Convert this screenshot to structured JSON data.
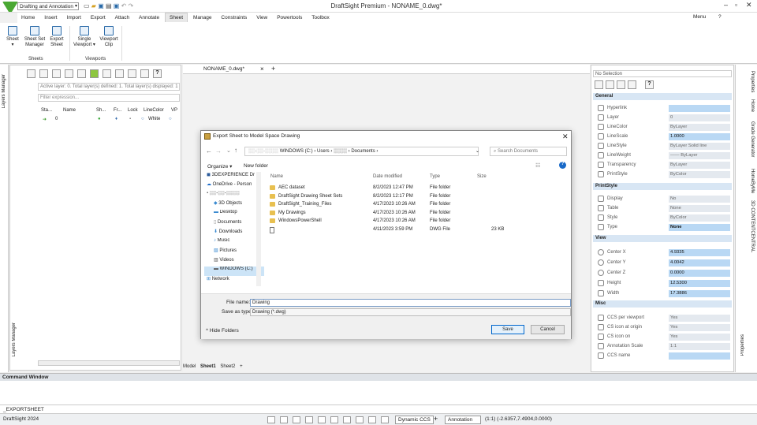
{
  "app": {
    "title": "DraftSight Premium - NONAME_0.dwg*",
    "workspace": "Drafting and Annotation",
    "menu_right": "Menu",
    "help": "?"
  },
  "menu": [
    "Home",
    "Insert",
    "Import",
    "Export",
    "Attach",
    "Annotate",
    "Sheet",
    "Manage",
    "Constraints",
    "View",
    "Powertools",
    "Toolbox"
  ],
  "ribbon": {
    "buttons": [
      {
        "label": "Sheet",
        "label2": "▾"
      },
      {
        "label": "Sheet Set",
        "label2": "Manager"
      },
      {
        "label": "Export",
        "label2": "Sheet"
      },
      {
        "label": "Single",
        "label2": "Viewport ▾"
      },
      {
        "label": "Viewport",
        "label2": "Clip"
      }
    ],
    "groups": [
      "Sheets",
      "Viewports"
    ]
  },
  "left_panel": {
    "tab_top": "Layers Manager",
    "tab_bottom": "Layers Manager",
    "info": "Active layer: 0. Total layer(s) defined: 1. Total layer(s) displayed: 1",
    "filter_placeholder": "Filter expression...",
    "columns": [
      "Sta...",
      "Name",
      "Sh...",
      "Fr...",
      "Lock",
      "LineColor",
      "VP"
    ],
    "row": {
      "name": "0",
      "color": "White"
    }
  },
  "drawing": {
    "tab": "NONAME_0.dwg*",
    "sheet_tabs": [
      "Model",
      "Sheet1",
      "Sheet2"
    ]
  },
  "properties": {
    "selection": "No Selection",
    "sections": {
      "general": "General",
      "printstyle": "PrintStyle",
      "view": "View",
      "misc": "Misc"
    },
    "general": [
      {
        "label": "Hyperlink",
        "value": ""
      },
      {
        "label": "Layer",
        "value": "0"
      },
      {
        "label": "LineColor",
        "value": "ByLayer"
      },
      {
        "label": "LineScale",
        "value": "1.0000"
      },
      {
        "label": "LineStyle",
        "value": "ByLayer    Solid line"
      },
      {
        "label": "LineWeight",
        "value": "—— ByLayer"
      },
      {
        "label": "Transparency",
        "value": "ByLayer"
      },
      {
        "label": "PrintStyle",
        "value": "ByColor"
      }
    ],
    "printstyle": [
      {
        "label": "Display",
        "value": "No"
      },
      {
        "label": "Table",
        "value": "None"
      },
      {
        "label": "Style",
        "value": "ByColor"
      },
      {
        "label": "Type",
        "value": "None"
      }
    ],
    "view": [
      {
        "label": "Center X",
        "value": "4.9335"
      },
      {
        "label": "Center Y",
        "value": "4.0042"
      },
      {
        "label": "Center Z",
        "value": "0.0000"
      },
      {
        "label": "Height",
        "value": "12.5300"
      },
      {
        "label": "Width",
        "value": "17.3886"
      }
    ],
    "misc": [
      {
        "label": "CCS per viewport",
        "value": "Yes"
      },
      {
        "label": "CS icon at origin",
        "value": "Yes"
      },
      {
        "label": "CS icon on",
        "value": "Yes"
      },
      {
        "label": "Annotation Scale",
        "value": "1:1"
      },
      {
        "label": "CCS name",
        "value": ""
      }
    ]
  },
  "right_tabs": [
    "Properties",
    "Home",
    "Grade Generator",
    "HomeByMe",
    "3D CONTENTCENTRAL",
    "Properties"
  ],
  "dialog": {
    "title": "Export Sheet to Model Space Drawing",
    "path": "WINDOWS (C:)  ›  Users  ›  ░░░░  ›  Documents  ›",
    "path_user": "░░-░░-░░░░",
    "search_placeholder": "Search Documents",
    "organize": "Organize ▾",
    "new_folder": "New folder",
    "nav": [
      {
        "label": "3DEXPERIENCE Dr"
      },
      {
        "label": "OneDrive - Person"
      },
      {
        "label": "░░-░░-░░░░"
      },
      {
        "label": "3D Objects"
      },
      {
        "label": "Desktop"
      },
      {
        "label": "Documents"
      },
      {
        "label": "Downloads"
      },
      {
        "label": "Music"
      },
      {
        "label": "Pictures"
      },
      {
        "label": "Videos"
      },
      {
        "label": "WINDOWS (C:)"
      },
      {
        "label": "Network"
      }
    ],
    "columns": [
      "Name",
      "Date modified",
      "Type",
      "Size"
    ],
    "files": [
      {
        "name": "AEC dataset",
        "date": "8/2/2023 12:47 PM",
        "type": "File folder",
        "size": ""
      },
      {
        "name": "DraftSight Drawing Sheet Sets",
        "date": "8/2/2023 12:17 PM",
        "type": "File folder",
        "size": ""
      },
      {
        "name": "DraftSight_Training_Files",
        "date": "4/17/2023 10:26 AM",
        "type": "File folder",
        "size": ""
      },
      {
        "name": "My Drawings",
        "date": "4/17/2023 10:26 AM",
        "type": "File folder",
        "size": ""
      },
      {
        "name": "WindowsPowerShell",
        "date": "4/17/2023 10:26 AM",
        "type": "File folder",
        "size": ""
      },
      {
        "name": "",
        "date": "4/11/2023 3:59 PM",
        "type": "DWG File",
        "size": "23 KB"
      }
    ],
    "filename_label": "File name:",
    "filename": "Drawing",
    "savetype_label": "Save as type:",
    "savetype": "Drawing (*.dwg)",
    "hide_folders": "Hide Folders",
    "save": "Save",
    "cancel": "Cancel"
  },
  "command": {
    "title": "Command Window",
    "line": "_EXPORTSHEET"
  },
  "status": {
    "app": "DraftSight 2024",
    "dynamic_ccs": "Dynamic CCS",
    "annotation": "Annotation",
    "coords": "(1:1)  (-2.6357,7.4904,0.0000)"
  }
}
